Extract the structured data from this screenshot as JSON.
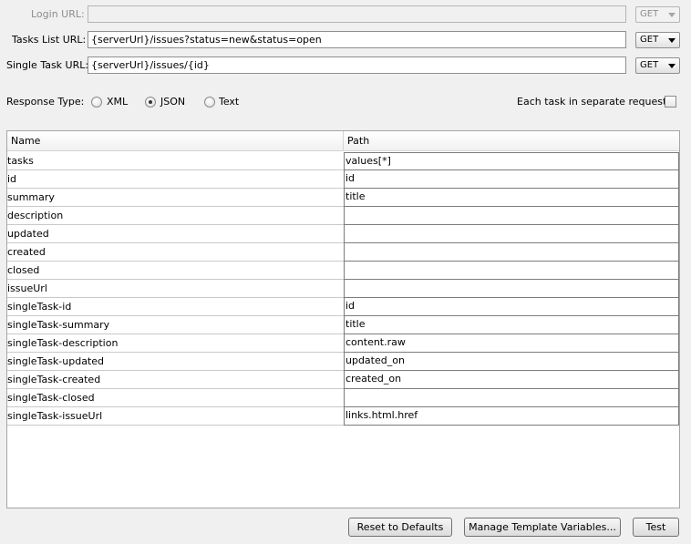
{
  "login": {
    "label": "Login URL:",
    "value": "",
    "method": "GET"
  },
  "tasks_list": {
    "label": "Tasks List URL:",
    "value": "{serverUrl}/issues?status=new&status=open",
    "method": "GET"
  },
  "single_task": {
    "label": "Single Task URL:",
    "value": "{serverUrl}/issues/{id}",
    "method": "GET"
  },
  "response_type": {
    "label": "Response Type:",
    "options": [
      {
        "label": "XML",
        "selected": false
      },
      {
        "label": "JSON",
        "selected": true
      },
      {
        "label": "Text",
        "selected": false
      }
    ]
  },
  "separate_request": {
    "label": "Each task in separate request:",
    "checked": false
  },
  "table": {
    "headers": [
      "Name",
      "Path"
    ],
    "rows": [
      {
        "name": "tasks",
        "path": "values[*]"
      },
      {
        "name": "id",
        "path": "id"
      },
      {
        "name": "summary",
        "path": "title"
      },
      {
        "name": "description",
        "path": ""
      },
      {
        "name": "updated",
        "path": ""
      },
      {
        "name": "created",
        "path": ""
      },
      {
        "name": "closed",
        "path": ""
      },
      {
        "name": "issueUrl",
        "path": ""
      },
      {
        "name": "singleTask-id",
        "path": "id"
      },
      {
        "name": "singleTask-summary",
        "path": "title"
      },
      {
        "name": "singleTask-description",
        "path": "content.raw"
      },
      {
        "name": "singleTask-updated",
        "path": "updated_on"
      },
      {
        "name": "singleTask-created",
        "path": "created_on"
      },
      {
        "name": "singleTask-closed",
        "path": ""
      },
      {
        "name": "singleTask-issueUrl",
        "path": "links.html.href"
      }
    ]
  },
  "buttons": {
    "reset": "Reset to Defaults",
    "manage": "Manage Template Variables...",
    "test": "Test"
  }
}
